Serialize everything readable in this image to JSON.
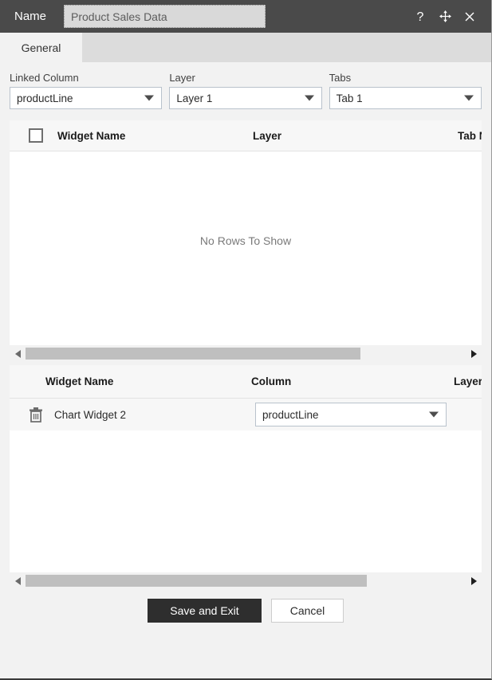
{
  "titlebar": {
    "label": "Name",
    "name_value": "Product Sales Data",
    "help_icon": "question-mark-icon",
    "move_icon": "move-arrows-icon",
    "close_icon": "close-icon"
  },
  "tabs": [
    {
      "label": "General",
      "active": true
    }
  ],
  "selectors": [
    {
      "label": "Linked Column",
      "value": "productLine"
    },
    {
      "label": "Layer",
      "value": "Layer 1"
    },
    {
      "label": "Tabs",
      "value": "Tab 1"
    }
  ],
  "widget_grid": {
    "columns": [
      "Widget Name",
      "Layer",
      "Tab Na"
    ],
    "select_all_checked": false,
    "empty_message": "No Rows To Show",
    "rows": []
  },
  "mapping_grid": {
    "columns": [
      "Widget Name",
      "Column",
      "Layer"
    ],
    "rows": [
      {
        "delete_icon": "trash-icon",
        "widget_name": "Chart Widget 2",
        "column_value": "productLine"
      }
    ]
  },
  "scrollbars": {
    "left_arrow": "scroll-left-arrow-icon",
    "right_arrow": "scroll-right-arrow-icon"
  },
  "footer": {
    "save_label": "Save and Exit",
    "cancel_label": "Cancel"
  },
  "colors": {
    "titlebar": "#4a4a4a",
    "tabstrip": "#dcdcdc",
    "panel": "#f2f2f2",
    "grid_header": "#f7f7f7",
    "primary_button": "#2e2e2e",
    "scroll_thumb": "#bfbfbf"
  }
}
